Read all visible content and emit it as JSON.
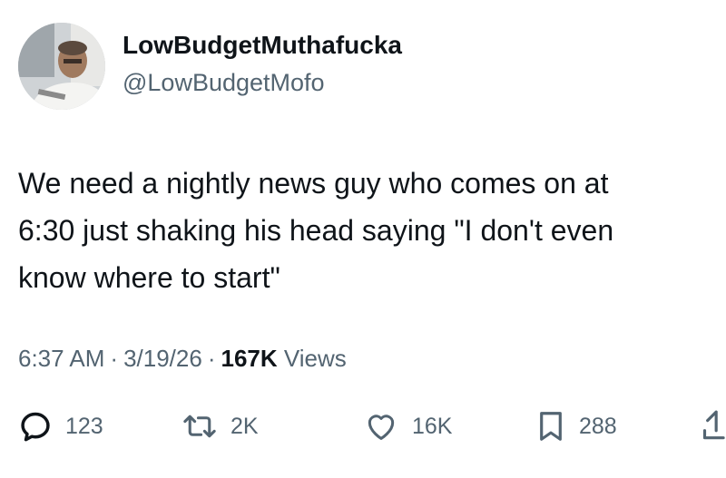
{
  "author": {
    "display_name": "LowBudgetMuthafucka",
    "handle": "@LowBudgetMofo"
  },
  "tweet": {
    "lines": [
      "We need a nightly news guy who comes on at",
      "6:30 just shaking his head saying \"I don't even",
      "know where to start\""
    ]
  },
  "meta": {
    "time": "6:37 AM",
    "separator": "·",
    "date": "3/19/26",
    "views_count": "167K",
    "views_label": "Views"
  },
  "actions": {
    "reply": {
      "icon": "reply-icon",
      "count": "123"
    },
    "retweet": {
      "icon": "retweet-icon",
      "count": "2K"
    },
    "like": {
      "icon": "heart-icon",
      "count": "16K"
    },
    "bookmark": {
      "icon": "bookmark-icon",
      "count": "288"
    },
    "share": {
      "icon": "share-icon"
    }
  },
  "colors": {
    "text_primary": "#0f1419",
    "text_secondary": "#536471",
    "background": "#ffffff"
  }
}
